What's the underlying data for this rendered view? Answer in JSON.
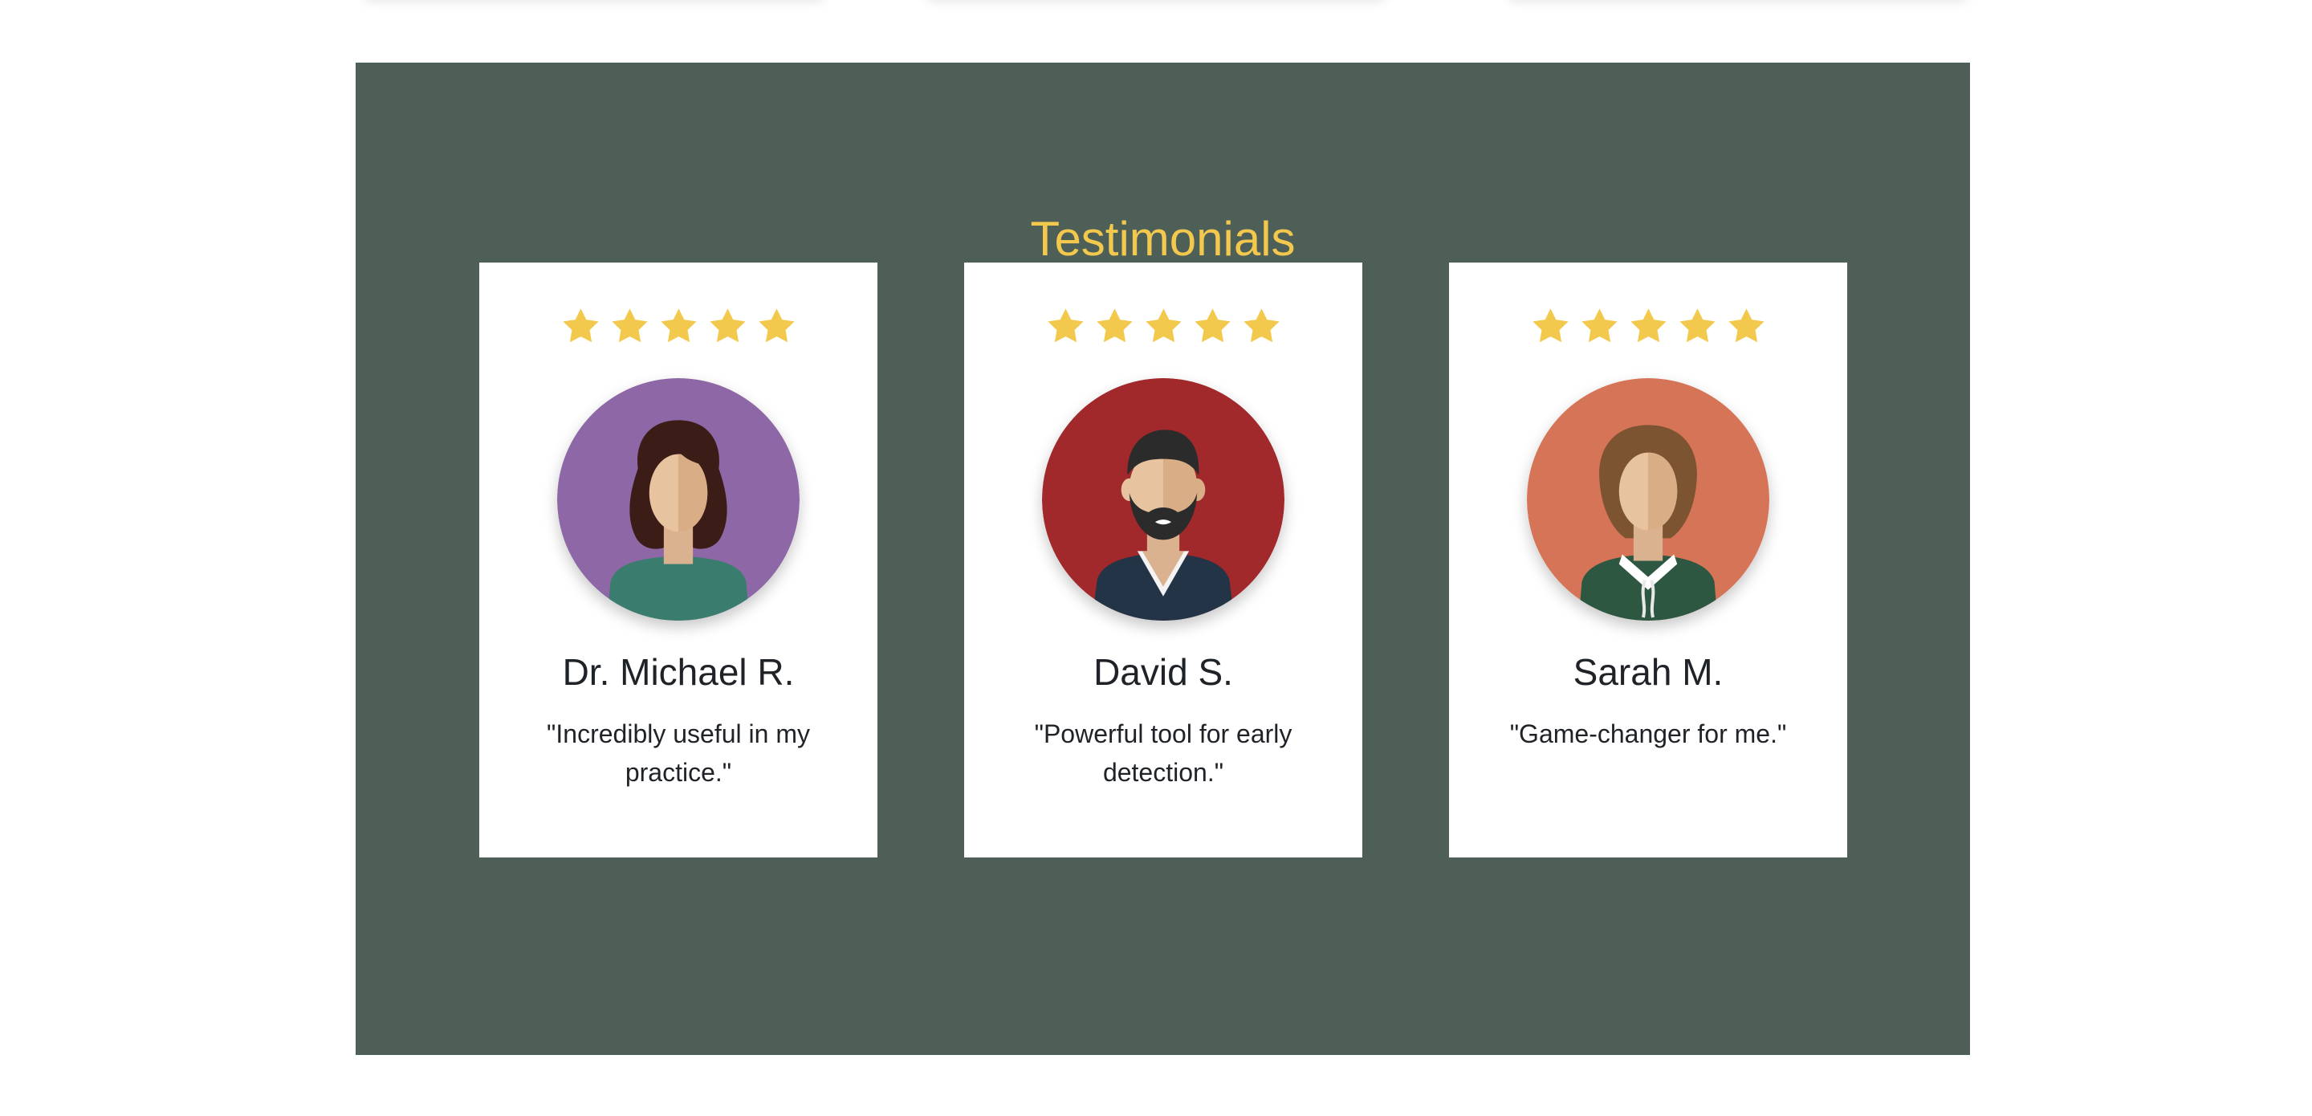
{
  "testimonials": {
    "title": "Testimonials",
    "colors": {
      "section_bg": "#4e5f58",
      "title": "#f2c94c",
      "star": "#f2c94c",
      "card_bg": "#ffffff"
    },
    "items": [
      {
        "rating": 5,
        "avatar_icon": "woman-curly-hair-avatar-icon",
        "avatar_bg": "#8e67a6",
        "name": "Dr. Michael R.",
        "quote": "\"Incredibly useful in my practice.\""
      },
      {
        "rating": 5,
        "avatar_icon": "bearded-man-avatar-icon",
        "avatar_bg": "#a1282b",
        "name": "David S.",
        "quote": "\"Powerful tool for early detection.\""
      },
      {
        "rating": 5,
        "avatar_icon": "woman-bob-hair-avatar-icon",
        "avatar_bg": "#d57456",
        "name": "Sarah M.",
        "quote": "\"Game-changer for me.\""
      }
    ]
  }
}
